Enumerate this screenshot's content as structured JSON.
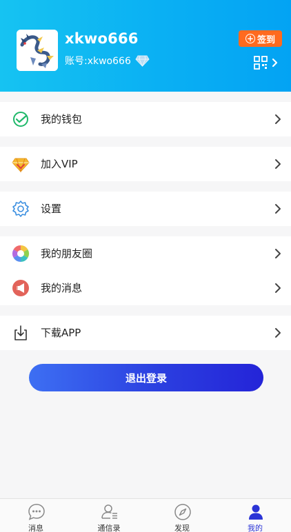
{
  "profile": {
    "username": "xkwo666",
    "account": "账号:xkwo666",
    "checkin_label": "签到",
    "avatar_desc": "dragon-avatar"
  },
  "menu": {
    "wallet": "我的钱包",
    "vip": "加入VIP",
    "settings": "设置",
    "moments": "我的朋友圈",
    "messages": "我的消息",
    "download": "下载APP"
  },
  "logout_label": "退出登录",
  "tabs": [
    {
      "label": "消息",
      "icon": "chat-bubble-icon"
    },
    {
      "label": "通信录",
      "icon": "contacts-icon"
    },
    {
      "label": "发现",
      "icon": "compass-icon"
    },
    {
      "label": "我的",
      "icon": "person-icon"
    }
  ],
  "colors": {
    "header_start": "#16c3f2",
    "header_end": "#03a3f3",
    "checkin": "#ff6a1f",
    "logout_start": "#3d6ff3",
    "logout_end": "#2424d8",
    "active_tab": "#2b34d6"
  }
}
